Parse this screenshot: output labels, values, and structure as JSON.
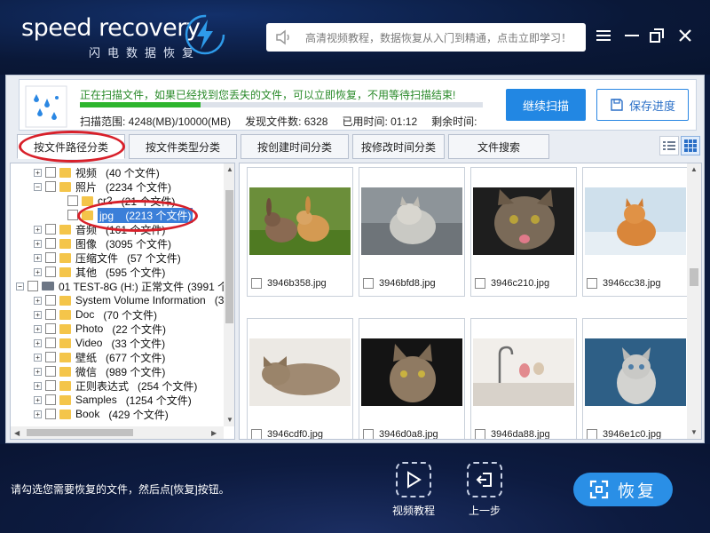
{
  "app": {
    "logo_text": "speed recovery",
    "logo_subtitle": "闪电数据恢复",
    "search_placeholder": "高清视频教程，数据恢复从入门到精通，点击立即学习！"
  },
  "status": {
    "message": "正在扫描文件，如果已经找到您丢失的文件，可以立即恢复，不用等待扫描结束!",
    "progress": 0.3,
    "scan_range": "扫描范围: 4248(MB)/10000(MB)",
    "found_files": "发现文件数: 6328",
    "elapsed": "已用时间: 01:12",
    "remaining": "剩余时间:",
    "continue_label": "继续扫描",
    "save_label": "保存进度"
  },
  "tabs": [
    {
      "label": "按文件路径分类"
    },
    {
      "label": "按文件类型分类"
    },
    {
      "label": "按创建时间分类"
    },
    {
      "label": "按修改时间分类"
    },
    {
      "label": "文件搜索"
    }
  ],
  "tree": [
    {
      "name": "视频",
      "count": "(40 个文件)"
    },
    {
      "name": "照片",
      "count": "(2234 个文件)"
    },
    {
      "name": "cr2",
      "count": "(21 个文件)"
    },
    {
      "name": "jpg",
      "count": "(2213 个文件)"
    },
    {
      "name": "音频",
      "count": "(161 个文件)"
    },
    {
      "name": "图像",
      "count": "(3095 个文件)"
    },
    {
      "name": "压缩文件",
      "count": "(57 个文件)"
    },
    {
      "name": "其他",
      "count": "(595 个文件)"
    },
    {
      "name": "01 TEST-8G (H:) 正常文件",
      "count": "(3991 个"
    },
    {
      "name": "System Volume Information",
      "count": "(3"
    },
    {
      "name": "Doc",
      "count": "(70 个文件)"
    },
    {
      "name": "Photo",
      "count": "(22 个文件)"
    },
    {
      "name": "Video",
      "count": "(33 个文件)"
    },
    {
      "name": "壁纸",
      "count": "(677 个文件)"
    },
    {
      "name": "微信",
      "count": "(989 个文件)"
    },
    {
      "name": "正则表达式",
      "count": "(254 个文件)"
    },
    {
      "name": "Samples",
      "count": "(1254 个文件)"
    },
    {
      "name": "Book",
      "count": "(429 个文件)"
    }
  ],
  "files": [
    {
      "name": "3946b358.jpg"
    },
    {
      "name": "3946bfd8.jpg"
    },
    {
      "name": "3946c210.jpg"
    },
    {
      "name": "3946cc38.jpg"
    },
    {
      "name": "3946cdf0.jpg"
    },
    {
      "name": "3946d0a8.jpg"
    },
    {
      "name": "3946da88.jpg"
    },
    {
      "name": "3946e1c0.jpg"
    }
  ],
  "footer": {
    "hint": "请勾选您需要恢复的文件，然后点[恢复]按钮。",
    "video_tutorial": "视频教程",
    "prev_step": "上一步",
    "recover": "恢复"
  },
  "colors": {
    "accent": "#2287e3",
    "annotation": "#d8202a",
    "progress": "#2db52d"
  }
}
